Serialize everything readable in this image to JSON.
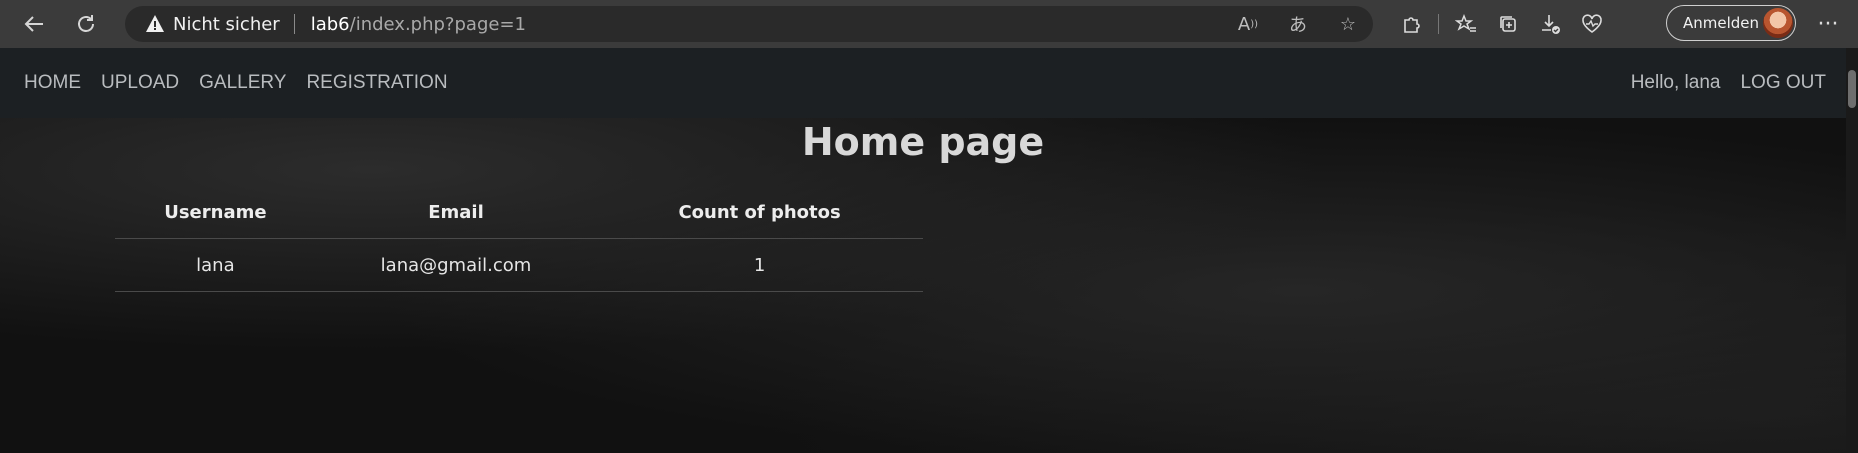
{
  "browser": {
    "security_label": "Nicht sicher",
    "url_host": "lab6",
    "url_path": "/index.php?page=1",
    "signin_label": "Anmelden",
    "icons": {
      "back": "back-arrow-icon",
      "reload": "reload-icon",
      "warning": "warning-icon",
      "read_aloud": "read-aloud-icon",
      "translate": "translate-icon",
      "favorite": "star-icon",
      "extensions": "puzzle-icon",
      "favorites": "favorites-icon",
      "collections": "collections-icon",
      "downloads": "downloads-icon",
      "health": "browser-essentials-icon",
      "more": "more-icon"
    }
  },
  "navbar": {
    "links": [
      "HOME",
      "UPLOAD",
      "GALLERY",
      "REGISTRATION"
    ],
    "greeting": "Hello, lana",
    "logout": "LOG OUT"
  },
  "main": {
    "title": "Home page",
    "table": {
      "headers": [
        "Username",
        "Email",
        "Count of photos"
      ],
      "rows": [
        [
          "lana",
          "lana@gmail.com",
          "1"
        ]
      ]
    }
  },
  "colors": {
    "chrome": "#3b3b3b",
    "navbar": "#1c2023",
    "background": "#111111"
  }
}
